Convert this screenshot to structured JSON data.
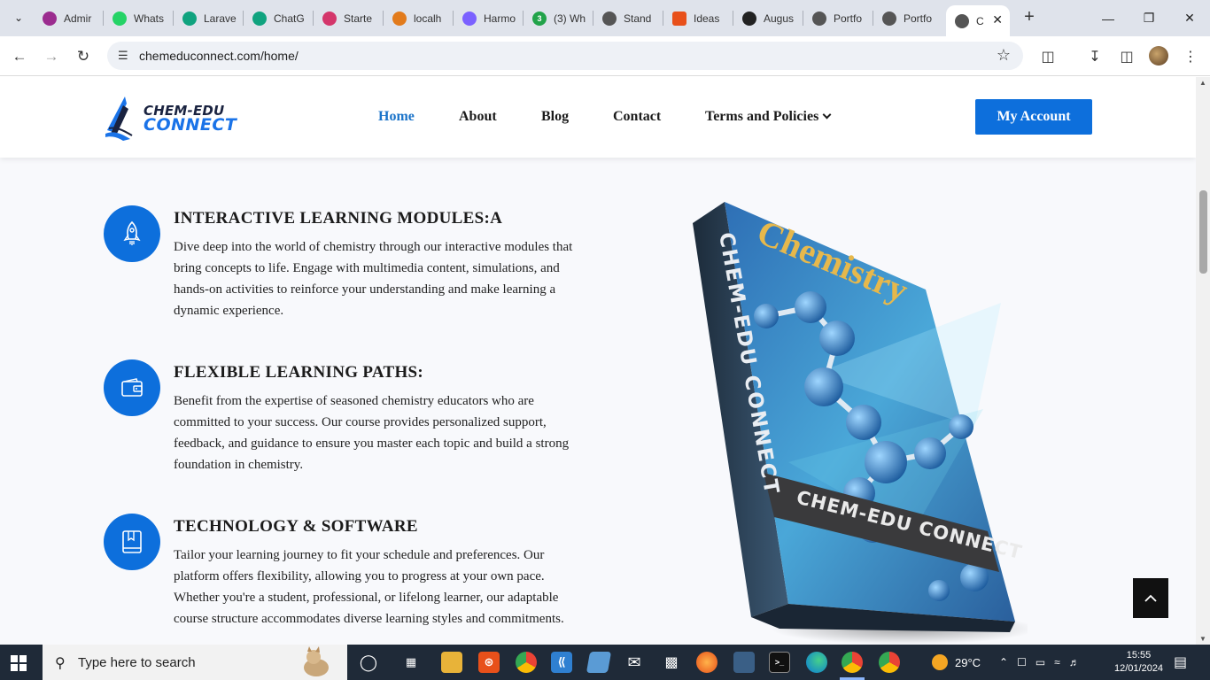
{
  "browser": {
    "tabs": [
      {
        "label": "Admir",
        "color": "#9b2c8f"
      },
      {
        "label": "Whats",
        "color": "#25d366"
      },
      {
        "label": "Larave",
        "color": "#10a37f"
      },
      {
        "label": "ChatG",
        "color": "#10a37f"
      },
      {
        "label": "Starte",
        "color": "#d4366b"
      },
      {
        "label": "localh",
        "color": "#e27b1c"
      },
      {
        "label": "Harmo",
        "color": "#7b61ff"
      },
      {
        "label": "(3) Wh",
        "color": "#22a34a"
      },
      {
        "label": "Stand",
        "color": "#555555"
      },
      {
        "label": "Ideas",
        "color": "#e8501a"
      },
      {
        "label": "Augus",
        "color": "#222222"
      },
      {
        "label": "Portfo",
        "color": "#555555"
      },
      {
        "label": "Portfo",
        "color": "#555555"
      },
      {
        "label": "C",
        "color": "#555555"
      }
    ],
    "url": "chemeduconnect.com/home/"
  },
  "site": {
    "logo_line1": "CHEM-EDU",
    "logo_line2": "CONNECT",
    "nav": [
      "Home",
      "About",
      "Blog",
      "Contact",
      "Terms and Policies"
    ],
    "account_button": "My Account",
    "accent": "#0d6fdc"
  },
  "features": [
    {
      "icon": "rocket-icon",
      "title": "INTERACTIVE LEARNING MODULES:A",
      "text": "Dive deep into the world of chemistry through our interactive modules that bring concepts to life. Engage with multimedia content, simulations, and hands-on activities to reinforce your understanding and make learning a dynamic experience."
    },
    {
      "icon": "wallet-icon",
      "title": "FLEXIBLE LEARNING PATHS:",
      "text": "Benefit from the expertise of seasoned chemistry educators who are committed to your success. Our course provides personalized support, feedback, and guidance to ensure you master each topic and build a strong foundation in chemistry."
    },
    {
      "icon": "book-icon",
      "title": "TECHNOLOGY & SOFTWARE",
      "text": "Tailor your learning journey to fit your schedule and preferences. Our platform offers flexibility, allowing you to progress at your own pace. Whether you're a student, professional, or lifelong learner, our adaptable course structure accommodates diverse learning styles and commitments."
    }
  ],
  "book": {
    "cover_title": "Chemistry",
    "spine_text": "CHEM-EDU CONNECT",
    "band_text": "CHEM-EDU CONNECT"
  },
  "taskbar": {
    "search_placeholder": "Type here to search",
    "weather": "29°C",
    "time": "15:55",
    "date": "12/01/2024"
  }
}
